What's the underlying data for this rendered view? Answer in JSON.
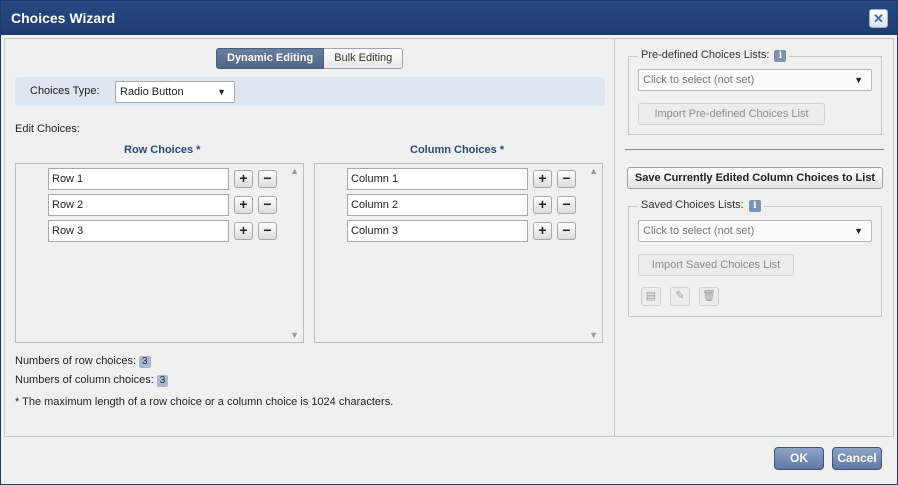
{
  "window": {
    "title": "Choices Wizard",
    "close_icon": "close-icon"
  },
  "left": {
    "mode_tabs": [
      {
        "label": "Dynamic Editing",
        "active": true
      },
      {
        "label": "Bulk Editing",
        "active": false
      }
    ],
    "choices_type": {
      "label": "Choices Type:",
      "value": "Radio Button"
    },
    "edit_choices_label": "Edit Choices:",
    "row_choices": {
      "title": "Row Choices *",
      "items": [
        "Row 1",
        "Row 2",
        "Row 3"
      ]
    },
    "column_choices": {
      "title": "Column Choices *",
      "items": [
        "Column 1",
        "Column 2",
        "Column 3"
      ]
    },
    "add_symbol": "+",
    "remove_symbol": "−",
    "stats": {
      "row_label": "Numbers of row choices:",
      "row_count": "3",
      "column_label": "Numbers of column choices:",
      "column_count": "3"
    },
    "note": "* The maximum length of a row choice or a column choice is 1024 characters."
  },
  "right": {
    "predefined": {
      "legend": "Pre-defined Choices Lists:",
      "info_symbol": "i",
      "placeholder": "Click to select (not set)",
      "import_label": "Import Pre-defined Choices List"
    },
    "save_button": "Save Currently Edited Column Choices to List",
    "saved": {
      "legend": "Saved Choices Lists:",
      "info_symbol": "i",
      "placeholder": "Click to select (not set)",
      "import_label": "Import Saved Choices List",
      "tools": [
        "save-icon",
        "edit-icon",
        "delete-icon"
      ]
    }
  },
  "footer": {
    "ok_label": "OK",
    "cancel_label": "Cancel"
  },
  "colors": {
    "titlebar": "#1e3b6e",
    "accent": "#4f6688",
    "badge": "#a9b8cf",
    "button": "#5f7aa5"
  }
}
